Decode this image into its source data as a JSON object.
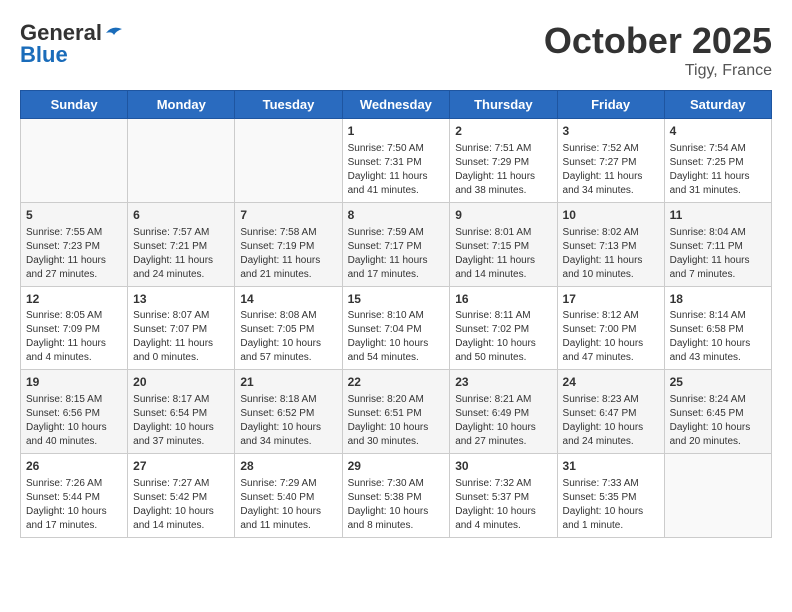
{
  "header": {
    "logo_general": "General",
    "logo_blue": "Blue",
    "month": "October 2025",
    "location": "Tigy, France"
  },
  "weekdays": [
    "Sunday",
    "Monday",
    "Tuesday",
    "Wednesday",
    "Thursday",
    "Friday",
    "Saturday"
  ],
  "weeks": [
    [
      {
        "day": "",
        "info": ""
      },
      {
        "day": "",
        "info": ""
      },
      {
        "day": "",
        "info": ""
      },
      {
        "day": "1",
        "info": "Sunrise: 7:50 AM\nSunset: 7:31 PM\nDaylight: 11 hours and 41 minutes."
      },
      {
        "day": "2",
        "info": "Sunrise: 7:51 AM\nSunset: 7:29 PM\nDaylight: 11 hours and 38 minutes."
      },
      {
        "day": "3",
        "info": "Sunrise: 7:52 AM\nSunset: 7:27 PM\nDaylight: 11 hours and 34 minutes."
      },
      {
        "day": "4",
        "info": "Sunrise: 7:54 AM\nSunset: 7:25 PM\nDaylight: 11 hours and 31 minutes."
      }
    ],
    [
      {
        "day": "5",
        "info": "Sunrise: 7:55 AM\nSunset: 7:23 PM\nDaylight: 11 hours and 27 minutes."
      },
      {
        "day": "6",
        "info": "Sunrise: 7:57 AM\nSunset: 7:21 PM\nDaylight: 11 hours and 24 minutes."
      },
      {
        "day": "7",
        "info": "Sunrise: 7:58 AM\nSunset: 7:19 PM\nDaylight: 11 hours and 21 minutes."
      },
      {
        "day": "8",
        "info": "Sunrise: 7:59 AM\nSunset: 7:17 PM\nDaylight: 11 hours and 17 minutes."
      },
      {
        "day": "9",
        "info": "Sunrise: 8:01 AM\nSunset: 7:15 PM\nDaylight: 11 hours and 14 minutes."
      },
      {
        "day": "10",
        "info": "Sunrise: 8:02 AM\nSunset: 7:13 PM\nDaylight: 11 hours and 10 minutes."
      },
      {
        "day": "11",
        "info": "Sunrise: 8:04 AM\nSunset: 7:11 PM\nDaylight: 11 hours and 7 minutes."
      }
    ],
    [
      {
        "day": "12",
        "info": "Sunrise: 8:05 AM\nSunset: 7:09 PM\nDaylight: 11 hours and 4 minutes."
      },
      {
        "day": "13",
        "info": "Sunrise: 8:07 AM\nSunset: 7:07 PM\nDaylight: 11 hours and 0 minutes."
      },
      {
        "day": "14",
        "info": "Sunrise: 8:08 AM\nSunset: 7:05 PM\nDaylight: 10 hours and 57 minutes."
      },
      {
        "day": "15",
        "info": "Sunrise: 8:10 AM\nSunset: 7:04 PM\nDaylight: 10 hours and 54 minutes."
      },
      {
        "day": "16",
        "info": "Sunrise: 8:11 AM\nSunset: 7:02 PM\nDaylight: 10 hours and 50 minutes."
      },
      {
        "day": "17",
        "info": "Sunrise: 8:12 AM\nSunset: 7:00 PM\nDaylight: 10 hours and 47 minutes."
      },
      {
        "day": "18",
        "info": "Sunrise: 8:14 AM\nSunset: 6:58 PM\nDaylight: 10 hours and 43 minutes."
      }
    ],
    [
      {
        "day": "19",
        "info": "Sunrise: 8:15 AM\nSunset: 6:56 PM\nDaylight: 10 hours and 40 minutes."
      },
      {
        "day": "20",
        "info": "Sunrise: 8:17 AM\nSunset: 6:54 PM\nDaylight: 10 hours and 37 minutes."
      },
      {
        "day": "21",
        "info": "Sunrise: 8:18 AM\nSunset: 6:52 PM\nDaylight: 10 hours and 34 minutes."
      },
      {
        "day": "22",
        "info": "Sunrise: 8:20 AM\nSunset: 6:51 PM\nDaylight: 10 hours and 30 minutes."
      },
      {
        "day": "23",
        "info": "Sunrise: 8:21 AM\nSunset: 6:49 PM\nDaylight: 10 hours and 27 minutes."
      },
      {
        "day": "24",
        "info": "Sunrise: 8:23 AM\nSunset: 6:47 PM\nDaylight: 10 hours and 24 minutes."
      },
      {
        "day": "25",
        "info": "Sunrise: 8:24 AM\nSunset: 6:45 PM\nDaylight: 10 hours and 20 minutes."
      }
    ],
    [
      {
        "day": "26",
        "info": "Sunrise: 7:26 AM\nSunset: 5:44 PM\nDaylight: 10 hours and 17 minutes."
      },
      {
        "day": "27",
        "info": "Sunrise: 7:27 AM\nSunset: 5:42 PM\nDaylight: 10 hours and 14 minutes."
      },
      {
        "day": "28",
        "info": "Sunrise: 7:29 AM\nSunset: 5:40 PM\nDaylight: 10 hours and 11 minutes."
      },
      {
        "day": "29",
        "info": "Sunrise: 7:30 AM\nSunset: 5:38 PM\nDaylight: 10 hours and 8 minutes."
      },
      {
        "day": "30",
        "info": "Sunrise: 7:32 AM\nSunset: 5:37 PM\nDaylight: 10 hours and 4 minutes."
      },
      {
        "day": "31",
        "info": "Sunrise: 7:33 AM\nSunset: 5:35 PM\nDaylight: 10 hours and 1 minute."
      },
      {
        "day": "",
        "info": ""
      }
    ]
  ]
}
